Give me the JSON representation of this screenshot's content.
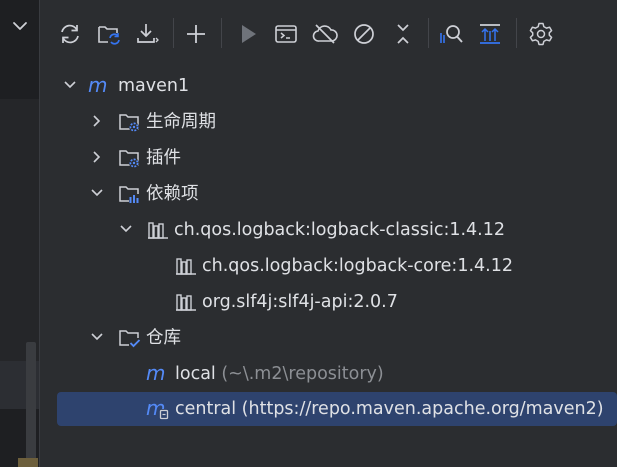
{
  "toolbar": {
    "buttons": [
      {
        "name": "reload-all-icon",
        "color": "#ced0d6"
      },
      {
        "name": "reload-folder-icon",
        "color": "#3574f0"
      },
      {
        "name": "download-icon",
        "color": "#ced0d6"
      },
      {
        "name": "add-icon",
        "color": "#ced0d6"
      },
      {
        "name": "run-icon",
        "color": "#6f737a"
      },
      {
        "name": "execute-goal-icon",
        "color": "#ced0d6"
      },
      {
        "name": "offline-mode-icon",
        "color": "#ced0d6"
      },
      {
        "name": "skip-tests-icon",
        "color": "#ced0d6"
      },
      {
        "name": "collapse-icon",
        "color": "#ced0d6"
      },
      {
        "name": "analyze-dependencies-icon",
        "color": "#3574f0"
      },
      {
        "name": "show-diagram-icon",
        "color": "#3574f0"
      },
      {
        "name": "settings-icon",
        "color": "#ced0d6"
      }
    ]
  },
  "tree": {
    "root": {
      "label": "maven1"
    },
    "lifecycle": {
      "label": "生命周期"
    },
    "plugins": {
      "label": "插件"
    },
    "dependencies": {
      "label": "依赖项"
    },
    "dep_classic": {
      "label": "ch.qos.logback:logback-classic:1.4.12"
    },
    "dep_core": {
      "label": "ch.qos.logback:logback-core:1.4.12"
    },
    "dep_slf4j": {
      "label": "org.slf4j:slf4j-api:2.0.7"
    },
    "repositories": {
      "label": "仓库"
    },
    "repo_local": {
      "label": "local",
      "hint": "(~\\.m2\\repository)"
    },
    "repo_central": {
      "label": "central (https://repo.maven.apache.org/maven2)"
    }
  },
  "colors": {
    "panel": "#2b2d30",
    "selection": "#2e436e",
    "accent": "#3574f0",
    "maven_m": "#548af7",
    "text": "#dfe1e5",
    "hint": "#8c8f94"
  }
}
